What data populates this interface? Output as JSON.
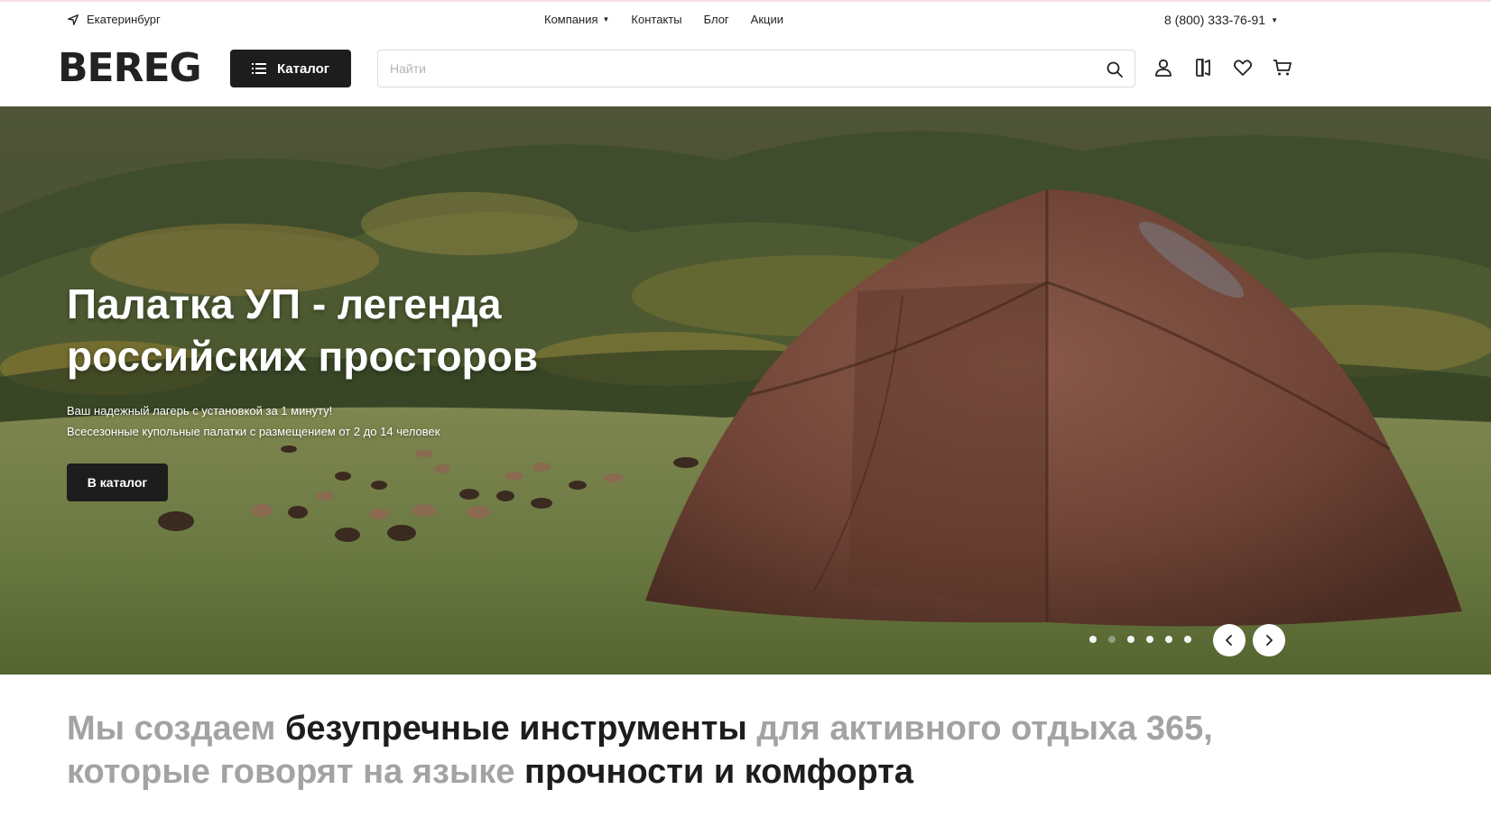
{
  "topbar": {
    "city": "Екатеринбург",
    "nav": [
      {
        "label": "Компания",
        "has_dropdown": true
      },
      {
        "label": "Контакты"
      },
      {
        "label": "Блог"
      },
      {
        "label": "Акции"
      }
    ],
    "phone": "8 (800) 333-76-91"
  },
  "header": {
    "logo": "BEREG",
    "catalog_label": "Каталог",
    "search_placeholder": "Найти",
    "icons": [
      "user-icon",
      "compare-icon",
      "heart-icon",
      "cart-icon"
    ]
  },
  "hero": {
    "title": "Палатка УП - легенда российских просторов",
    "subtitle_line1": "Ваш надежный лагерь с установкой за 1 минуту!",
    "subtitle_line2": "Всесезонные купольные палатки с размещением от 2 до 14 человек",
    "button_label": "В каталог",
    "slides_count": 6,
    "active_slide": 1
  },
  "statement": {
    "part1": "Мы создаем ",
    "part2": "безупречные инструменты",
    "part3": " для активного отдыха 365,",
    "part4": "которые говорят на языке ",
    "part5": "прочности и комфорта"
  },
  "colors": {
    "dark": "#1d1d1d",
    "muted": "#a3a3a3",
    "accent_line": "#f6dfe3"
  }
}
